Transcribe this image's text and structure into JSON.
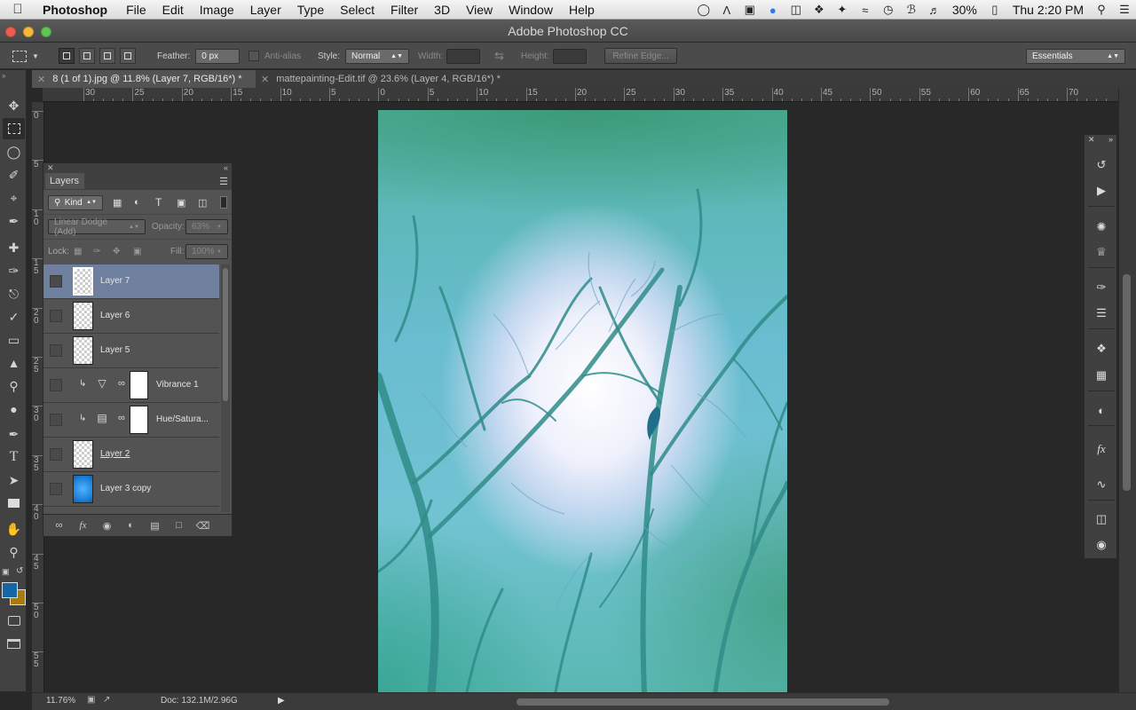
{
  "menubar": {
    "app_name": "Photoshop",
    "items": [
      "File",
      "Edit",
      "Image",
      "Layer",
      "Type",
      "Select",
      "Filter",
      "3D",
      "View",
      "Window",
      "Help"
    ],
    "battery": "30%",
    "clock": "Thu 2:20 PM"
  },
  "window": {
    "title": "Adobe Photoshop CC"
  },
  "options": {
    "feather_label": "Feather:",
    "feather_value": "0 px",
    "antialias_label": "Anti-alias",
    "style_label": "Style:",
    "style_value": "Normal",
    "width_label": "Width:",
    "height_label": "Height:",
    "refine_edge": "Refine Edge...",
    "workspace": "Essentials"
  },
  "tabs": [
    {
      "label": "8 (1 of 1).jpg @ 11.8% (Layer 7, RGB/16*) *"
    },
    {
      "label": "mattepainting-Edit.tif @ 23.6% (Layer 4, RGB/16*) *"
    }
  ],
  "ruler_h": [
    "30",
    "25",
    "20",
    "15",
    "10",
    "5",
    "0",
    "5",
    "10",
    "15",
    "20",
    "25",
    "30",
    "35",
    "40",
    "45",
    "50",
    "55",
    "60",
    "65",
    "70"
  ],
  "ruler_v": [
    "0",
    "5",
    "1 0",
    "1 5",
    "2 0",
    "2 5",
    "3 0",
    "3 5",
    "4 0",
    "4 5",
    "5 0",
    "5 5"
  ],
  "layers_panel": {
    "tab": "Layers",
    "filter_kind": "Kind",
    "blend_mode": "Linear Dodge (Add)",
    "opacity_label": "Opacity:",
    "opacity_value": "63%",
    "lock_label": "Lock:",
    "fill_label": "Fill:",
    "fill_value": "100%",
    "layers": [
      {
        "name": "Layer 7"
      },
      {
        "name": "Layer 6"
      },
      {
        "name": "Layer 5"
      },
      {
        "name": "Vibrance 1"
      },
      {
        "name": "Hue/Satura..."
      },
      {
        "name": "Layer 2"
      },
      {
        "name": "Layer 3 copy"
      }
    ]
  },
  "status": {
    "zoom": "11.76%",
    "doc": "Doc: 132.1M/2.96G"
  },
  "colors": {
    "foreground": "#1566a6",
    "background": "#a87b12",
    "selected_layer": "#6f7f9e"
  },
  "icons": {
    "toolbar": [
      "move-icon",
      "marquee-icon",
      "lasso-icon",
      "quick-select-icon",
      "crop-icon",
      "eyedropper-icon",
      "healing-icon",
      "brush-icon",
      "stamp-icon",
      "history-brush-icon",
      "eraser-icon",
      "gradient-icon",
      "dodge-icon",
      "pen-icon",
      "type-icon",
      "path-select-icon",
      "shape-icon",
      "hand-icon",
      "zoom-icon"
    ],
    "dock": [
      "history-icon",
      "actions-icon",
      "brush-presets-icon",
      "clone-source-icon",
      "tool-presets-icon",
      "adjustments-icon",
      "swatches-icon",
      "styles-icon",
      "color-icon",
      "channels-icon",
      "paths-icon",
      "3d-icon",
      "properties-icon"
    ]
  }
}
